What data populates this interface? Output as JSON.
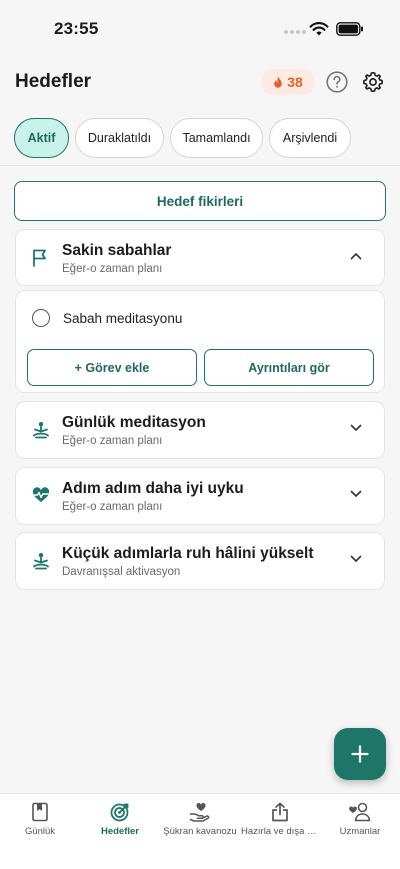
{
  "status": {
    "time": "23:55"
  },
  "header": {
    "title": "Hedefler",
    "streak_count": "38"
  },
  "tabs": [
    {
      "label": "Aktif",
      "active": true
    },
    {
      "label": "Duraklatıldı",
      "active": false
    },
    {
      "label": "Tamamlandı",
      "active": false
    },
    {
      "label": "Arşivlendi",
      "active": false
    }
  ],
  "ideas_button": "Hedef fikirleri",
  "goals": [
    {
      "title": "Sakin sabahlar",
      "subtitle": "Eğer-o zaman planı",
      "icon": "flag-icon",
      "expanded": true
    },
    {
      "title": "Günlük meditasyon",
      "subtitle": "Eğer-o zaman planı",
      "icon": "meditation-icon",
      "expanded": false
    },
    {
      "title": "Adım adım daha iyi uyku",
      "subtitle": "Eğer-o zaman planı",
      "icon": "heartbeat-icon",
      "expanded": false
    },
    {
      "title": "Küçük adımlarla ruh hâlini yükselt",
      "subtitle": "Davranışsal aktivasyon",
      "icon": "meditation-icon",
      "expanded": false
    }
  ],
  "expanded_goal": {
    "task": "Sabah meditasyonu",
    "add_task_label": "+ Görev ekle",
    "details_label": "Ayrıntıları gör"
  },
  "bottom_nav": [
    {
      "label": "Günlük",
      "icon": "journal-icon",
      "active": false
    },
    {
      "label": "Hedefler",
      "icon": "target-icon",
      "active": true
    },
    {
      "label": "Şükran kavanozu",
      "icon": "gratitude-icon",
      "active": false
    },
    {
      "label": "Hazırla ve dışa aktar",
      "icon": "share-icon",
      "active": false
    },
    {
      "label": "Uzmanlar",
      "icon": "experts-icon",
      "active": false
    }
  ],
  "colors": {
    "accent": "#1e7668",
    "accent_light": "#c8f2ea",
    "streak_bg": "#fdebe3",
    "streak_text": "#e0632c"
  }
}
